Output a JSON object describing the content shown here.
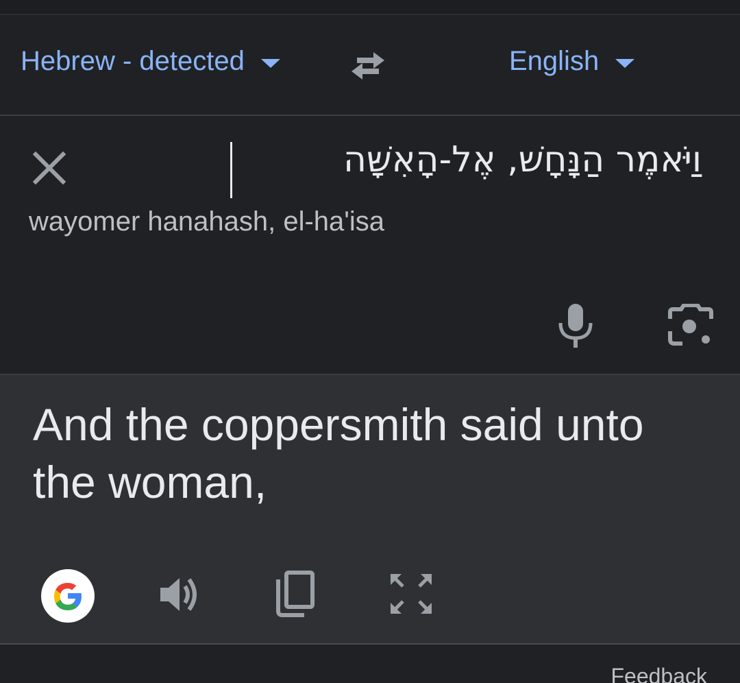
{
  "language_bar": {
    "source_language": "Hebrew - detected",
    "target_language": "English",
    "swap_icon": "swap-horiz-icon"
  },
  "input": {
    "source_text": "וַיֹּאמֶר הַנָּחָשׁ, אֶל-הָאִשָּׁה",
    "transliteration": "wayomer hanahash, el-ha'isa",
    "icons": [
      "close-icon",
      "microphone-icon",
      "camera-icon"
    ]
  },
  "output": {
    "translation": "And the coppersmith said unto the woman,",
    "icons": [
      "google-logo",
      "volume-up-icon",
      "copy-icon",
      "fullscreen-icon"
    ]
  },
  "footer": {
    "feedback_label": "Feedback"
  },
  "colors": {
    "background": "#202124",
    "output_background": "#2f3033",
    "accent_blue": "#8ab4f8",
    "text_primary": "#e8eaed",
    "text_secondary": "#bdc1c6",
    "icon_gray": "#9aa0a6"
  }
}
